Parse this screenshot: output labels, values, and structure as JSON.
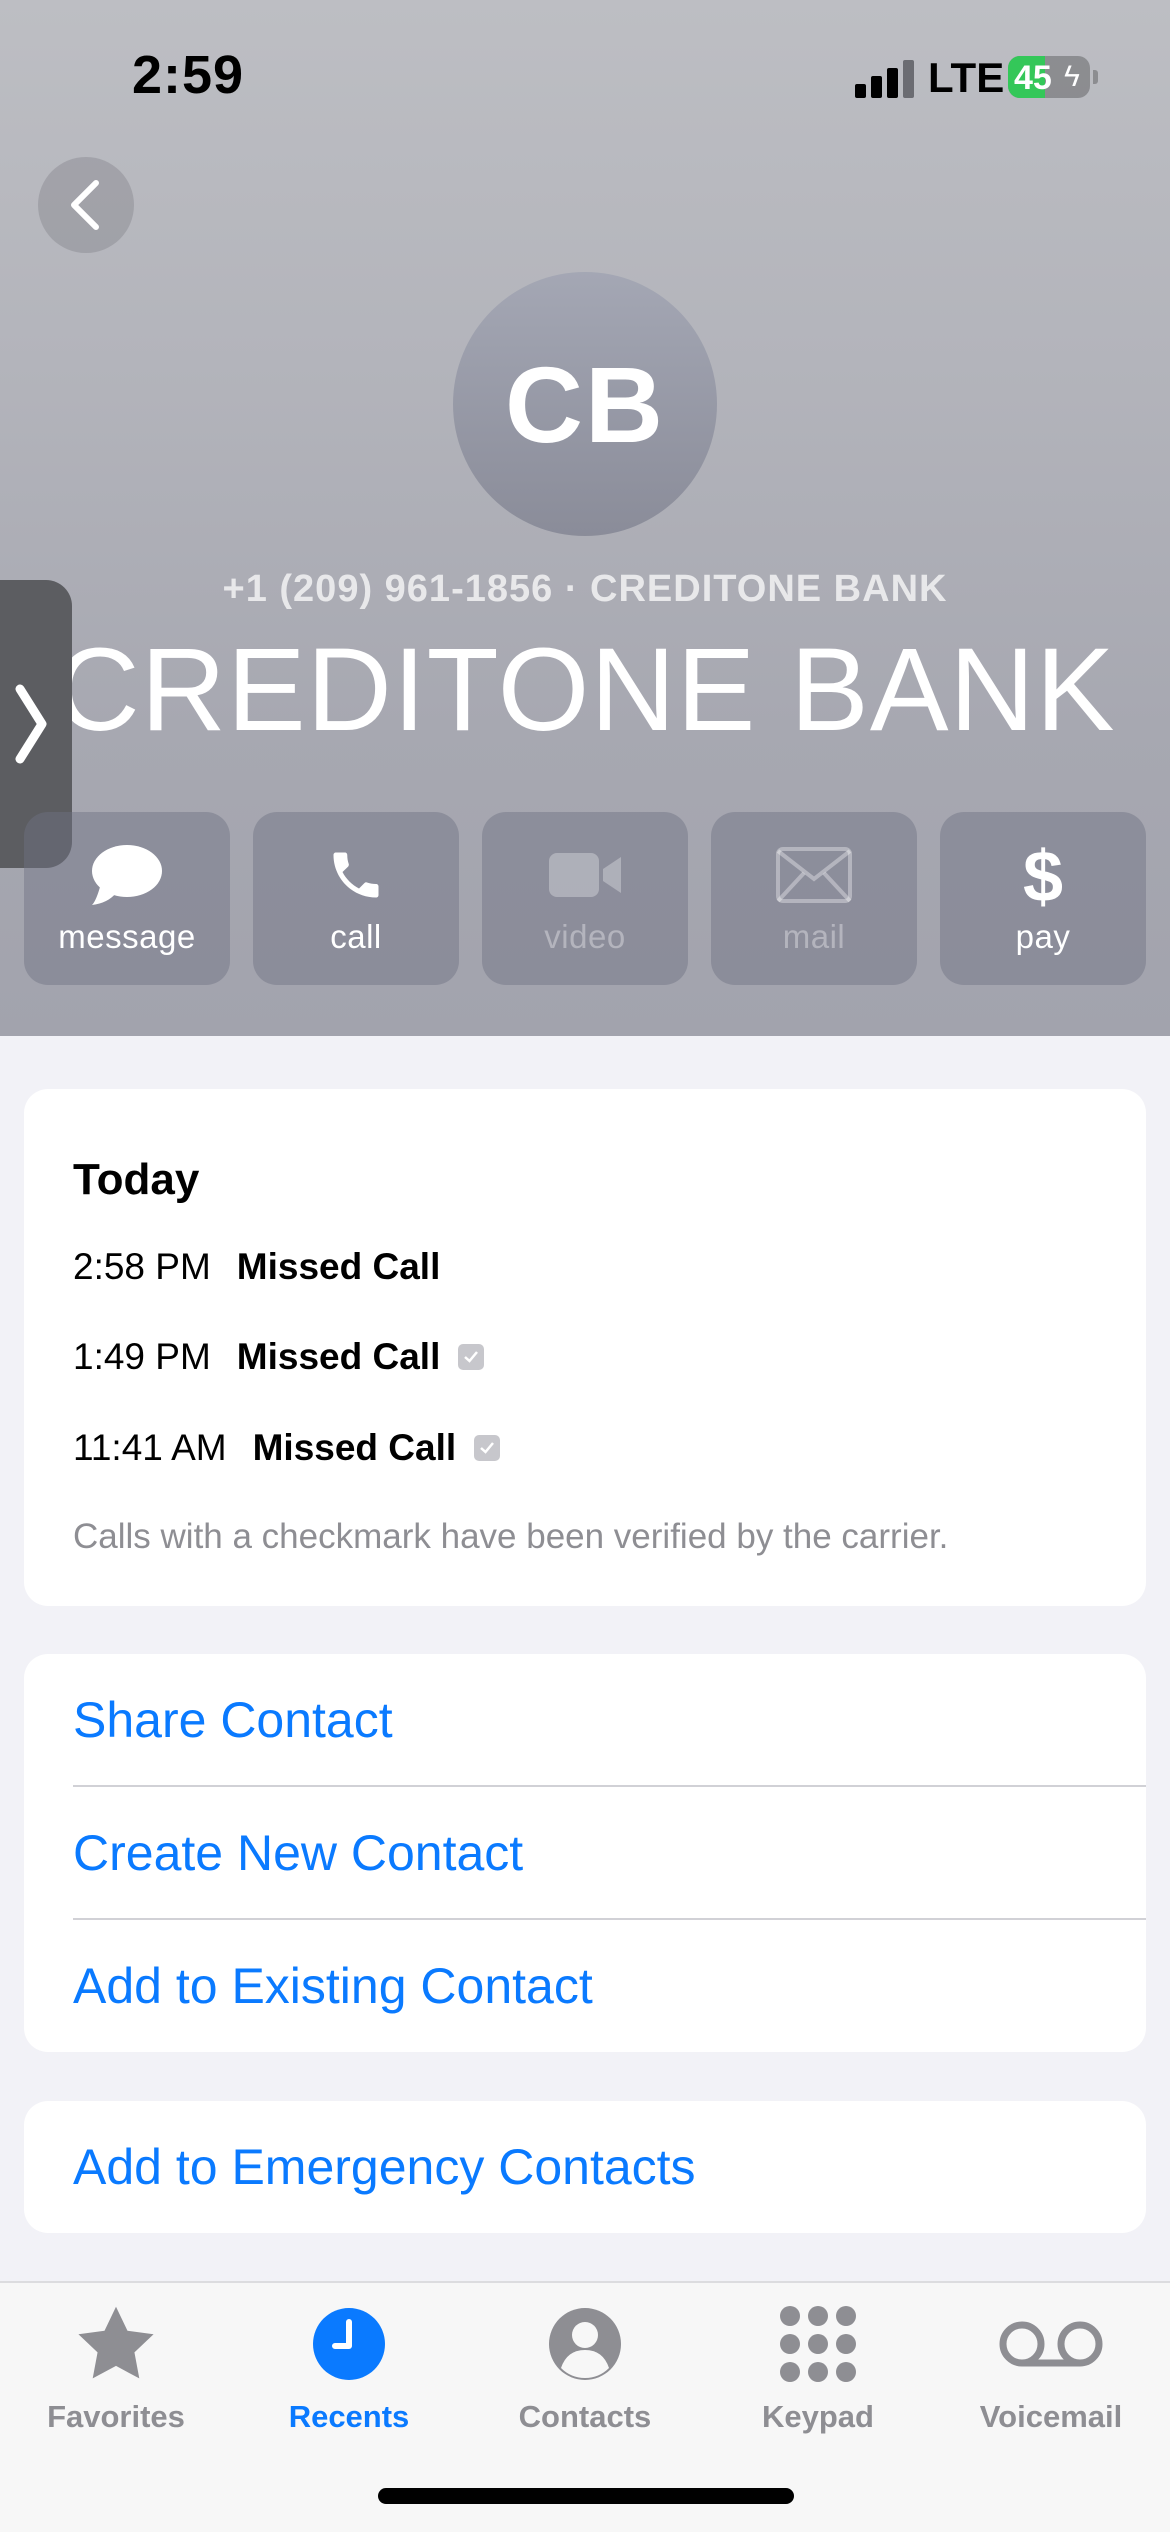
{
  "status": {
    "time": "2:59",
    "network": "LTE",
    "battery": "45",
    "battery_level": 0.45
  },
  "header": {
    "initials": "CB",
    "subtitle": "+1 (209) 961-1856 · CREDITONE BANK",
    "name": "CREDITONE BANK"
  },
  "actions": [
    {
      "label": "message",
      "icon": "message-bubble-icon",
      "enabled": true
    },
    {
      "label": "call",
      "icon": "phone-icon",
      "enabled": true
    },
    {
      "label": "video",
      "icon": "video-camera-icon",
      "enabled": false
    },
    {
      "label": "mail",
      "icon": "envelope-icon",
      "enabled": false
    },
    {
      "label": "pay",
      "icon": "dollar-icon",
      "enabled": true
    }
  ],
  "calls": {
    "section_title": "Today",
    "items": [
      {
        "time": "2:58 PM",
        "type": "Missed Call",
        "verified": false
      },
      {
        "time": "1:49 PM",
        "type": "Missed Call",
        "verified": true
      },
      {
        "time": "11:41 AM",
        "type": "Missed Call",
        "verified": true
      }
    ],
    "note": "Calls with a checkmark have been verified by the carrier."
  },
  "contact_actions": {
    "share": "Share Contact",
    "create": "Create New Contact",
    "add_existing": "Add to Existing Contact",
    "emergency": "Add to Emergency Contacts"
  },
  "tabbar": {
    "tabs": [
      {
        "label": "Favorites",
        "icon": "star-icon",
        "active": false
      },
      {
        "label": "Recents",
        "icon": "clock-icon",
        "active": true
      },
      {
        "label": "Contacts",
        "icon": "person-circle-icon",
        "active": false
      },
      {
        "label": "Keypad",
        "icon": "keypad-icon",
        "active": false
      },
      {
        "label": "Voicemail",
        "icon": "voicemail-icon",
        "active": false
      }
    ]
  },
  "colors": {
    "accent": "#0a7aff",
    "battery_green": "#34c759",
    "gray_text": "#8e8e93"
  }
}
